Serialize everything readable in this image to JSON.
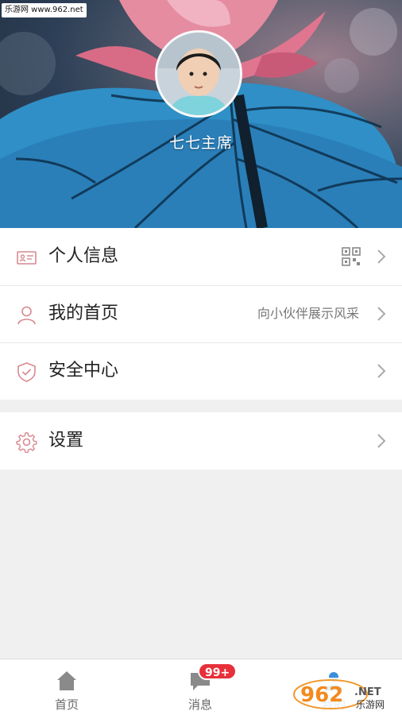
{
  "watermark": {
    "text": "乐游网 www.962.net"
  },
  "profile": {
    "username": "七七主席"
  },
  "menu_group_1": [
    {
      "label": "个人信息",
      "icon": "id-card-icon",
      "trailing_icon": "qr-code-icon"
    },
    {
      "label": "我的首页",
      "icon": "person-icon",
      "subtitle": "向小伙伴展示风采"
    },
    {
      "label": "安全中心",
      "icon": "shield-icon"
    }
  ],
  "menu_group_2": [
    {
      "label": "设置",
      "icon": "gear-icon"
    }
  ],
  "tabbar": {
    "tabs": [
      {
        "label": "首页",
        "icon": "home-icon"
      },
      {
        "label": "消息",
        "icon": "message-icon",
        "badge": "99+"
      },
      {
        "label": "我的",
        "icon": "user-icon"
      }
    ]
  },
  "logo": {
    "brand_text": "962",
    "suffix_text": ".NET",
    "site_text": "乐游网"
  },
  "colors": {
    "accent_icon": "#d9888f",
    "badge": "#e8303a",
    "background": "#f0f0f0"
  }
}
